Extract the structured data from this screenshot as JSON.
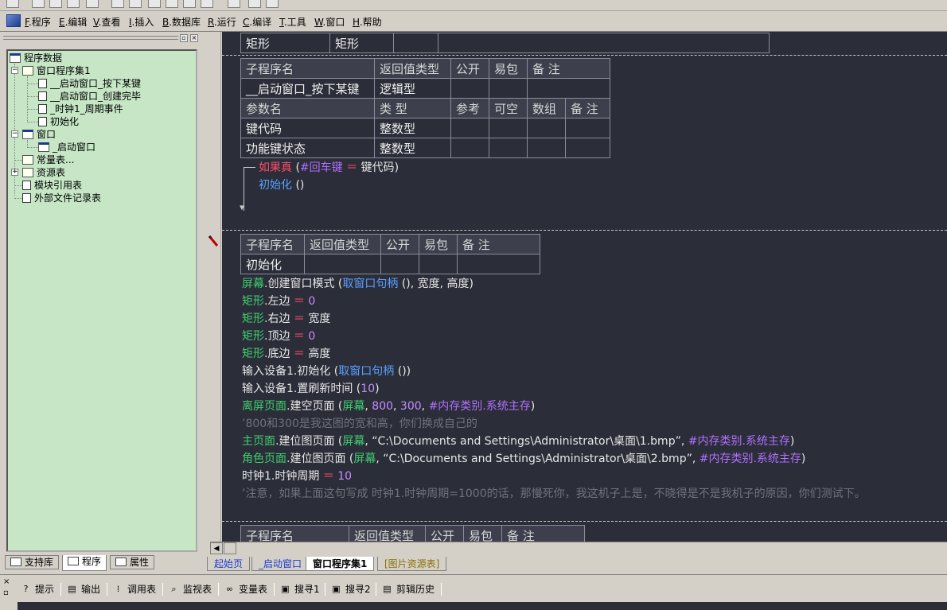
{
  "menubar": {
    "items": [
      {
        "key": "F",
        "label": ".程序"
      },
      {
        "key": "E",
        "label": ".编辑"
      },
      {
        "key": "V",
        "label": ".查看"
      },
      {
        "key": "I",
        "label": ".插入"
      },
      {
        "key": "B",
        "label": ".数据库"
      },
      {
        "key": "R",
        "label": ".运行"
      },
      {
        "key": "C",
        "label": ".编译"
      },
      {
        "key": "T",
        "label": ".工具"
      },
      {
        "key": "W",
        "label": ".窗口"
      },
      {
        "key": "H",
        "label": ".帮助"
      }
    ]
  },
  "tree": {
    "root": "程序数据",
    "program_set": "窗口程序集1",
    "subs": [
      "__启动窗口_按下某键",
      "__启动窗口_创建完毕",
      "_时钟1_周期事件",
      "初始化"
    ],
    "windows": "窗口",
    "window_item": "_启动窗口",
    "constants": "常量表...",
    "resources": "资源表",
    "module_refs": "模块引用表",
    "external_files": "外部文件记录表"
  },
  "left_tabs": [
    "支持库",
    "程序",
    "属性"
  ],
  "editor": {
    "top_row": [
      "矩形",
      "矩形"
    ],
    "sub1": {
      "headers": [
        "子程序名",
        "返回值类型",
        "公开",
        "易包",
        "备 注"
      ],
      "row": [
        "__启动窗口_按下某键",
        "逻辑型",
        "",
        "",
        ""
      ],
      "param_headers": [
        "参数名",
        "类 型",
        "参考",
        "可空",
        "数组",
        "备 注"
      ],
      "params": [
        [
          "键代码",
          "整数型",
          "",
          "",
          "",
          ""
        ],
        [
          "功能键状态",
          "整数型",
          "",
          "",
          "",
          ""
        ]
      ],
      "code": {
        "if_kw": "如果真",
        "if_open": " (",
        "if_const": "#回车键",
        "if_eq": " ＝ ",
        "if_var": "键代码",
        "if_close": ")",
        "call": "初始化",
        "call_args": " ()"
      }
    },
    "sub2": {
      "headers": [
        "子程序名",
        "返回值类型",
        "公开",
        "易包",
        "备 注"
      ],
      "row": [
        "初始化",
        "",
        "",
        "",
        ""
      ]
    },
    "code_lines": [
      [
        {
          "t": "屏幕",
          "c": "g"
        },
        {
          "t": ".创建窗口模式 (",
          "c": "w"
        },
        {
          "t": "取窗口句柄",
          "c": "b"
        },
        {
          "t": " (), 宽度, 高度)",
          "c": "w"
        }
      ],
      [
        {
          "t": "矩形",
          "c": "g"
        },
        {
          "t": ".左边 ",
          "c": "w"
        },
        {
          "t": "＝",
          "c": "r"
        },
        {
          "t": " 0",
          "c": "m"
        }
      ],
      [
        {
          "t": "矩形",
          "c": "g"
        },
        {
          "t": ".右边 ",
          "c": "w"
        },
        {
          "t": "＝",
          "c": "r"
        },
        {
          "t": " 宽度",
          "c": "w"
        }
      ],
      [
        {
          "t": "矩形",
          "c": "g"
        },
        {
          "t": ".顶边 ",
          "c": "w"
        },
        {
          "t": "＝",
          "c": "r"
        },
        {
          "t": " 0",
          "c": "m"
        }
      ],
      [
        {
          "t": "矩形",
          "c": "g"
        },
        {
          "t": ".底边 ",
          "c": "w"
        },
        {
          "t": "＝",
          "c": "r"
        },
        {
          "t": " 高度",
          "c": "w"
        }
      ],
      [
        {
          "t": "输入设备1.初始化 (",
          "c": "w"
        },
        {
          "t": "取窗口句柄",
          "c": "b"
        },
        {
          "t": " ())",
          "c": "w"
        }
      ],
      [
        {
          "t": "输入设备1.置刷新时间 (",
          "c": "w"
        },
        {
          "t": "10",
          "c": "m"
        },
        {
          "t": ")",
          "c": "w"
        }
      ],
      [
        {
          "t": "离屏页面",
          "c": "g"
        },
        {
          "t": ".建空页面 (",
          "c": "w"
        },
        {
          "t": "屏幕",
          "c": "g"
        },
        {
          "t": ", ",
          "c": "w"
        },
        {
          "t": "800",
          "c": "m"
        },
        {
          "t": ", ",
          "c": "w"
        },
        {
          "t": "300",
          "c": "m"
        },
        {
          "t": ", ",
          "c": "w"
        },
        {
          "t": "#内存类别.系统主存",
          "c": "p"
        },
        {
          "t": ")",
          "c": "w"
        }
      ],
      [
        {
          "t": "’800和300是我这图的宽和高，你们换成自己的",
          "c": "c"
        }
      ],
      [
        {
          "t": "主页面",
          "c": "g"
        },
        {
          "t": ".建位图页面 (",
          "c": "w"
        },
        {
          "t": "屏幕",
          "c": "g"
        },
        {
          "t": ", “C:\\Documents and Settings\\Administrator\\桌面\\1.bmp”, ",
          "c": "w"
        },
        {
          "t": "#内存类别.系统主存",
          "c": "p"
        },
        {
          "t": ")",
          "c": "w"
        }
      ],
      [
        {
          "t": "角色页面",
          "c": "g"
        },
        {
          "t": ".建位图页面 (",
          "c": "w"
        },
        {
          "t": "屏幕",
          "c": "g"
        },
        {
          "t": ", “C:\\Documents and Settings\\Administrator\\桌面\\2.bmp”, ",
          "c": "w"
        },
        {
          "t": "#内存类别.系统主存",
          "c": "p"
        },
        {
          "t": ")",
          "c": "w"
        }
      ],
      [
        {
          "t": "时钟1.时钟周期 ",
          "c": "w"
        },
        {
          "t": "＝",
          "c": "r"
        },
        {
          "t": " 10",
          "c": "m"
        }
      ],
      [
        {
          "t": "’注意，如果上面这句写成 时钟1.时钟周期=1000的话，那慢死你，我这机子上是，不晓得是不是我机子的原因，你们测试下。",
          "c": "c"
        }
      ]
    ],
    "sub3": {
      "headers": [
        "子程序名",
        "返回值类型",
        "公开",
        "易包",
        "备 注"
      ]
    }
  },
  "doc_tabs": [
    "起始页",
    "_启动窗口",
    "窗口程序集1",
    "[图片资源表]"
  ],
  "bottom_tabs": [
    {
      "icon": "?",
      "label": "提示"
    },
    {
      "icon": "▤",
      "label": "输出"
    },
    {
      "icon": "⁞",
      "label": "调用表"
    },
    {
      "icon": "⌕",
      "label": "监视表"
    },
    {
      "icon": "∞",
      "label": "变量表"
    },
    {
      "icon": "▣",
      "label": "搜寻1"
    },
    {
      "icon": "▣",
      "label": "搜寻2"
    },
    {
      "icon": "▤",
      "label": "剪辑历史"
    }
  ],
  "colors": {
    "editor_bg": "#2b2d38",
    "tree_bg": "#c6e6c6",
    "keyword_green": "#3fcf6f",
    "func_blue": "#5aa0ff",
    "const_purple": "#b070ff",
    "operator_red": "#ff4d6a",
    "comment_gray": "#70727c"
  }
}
